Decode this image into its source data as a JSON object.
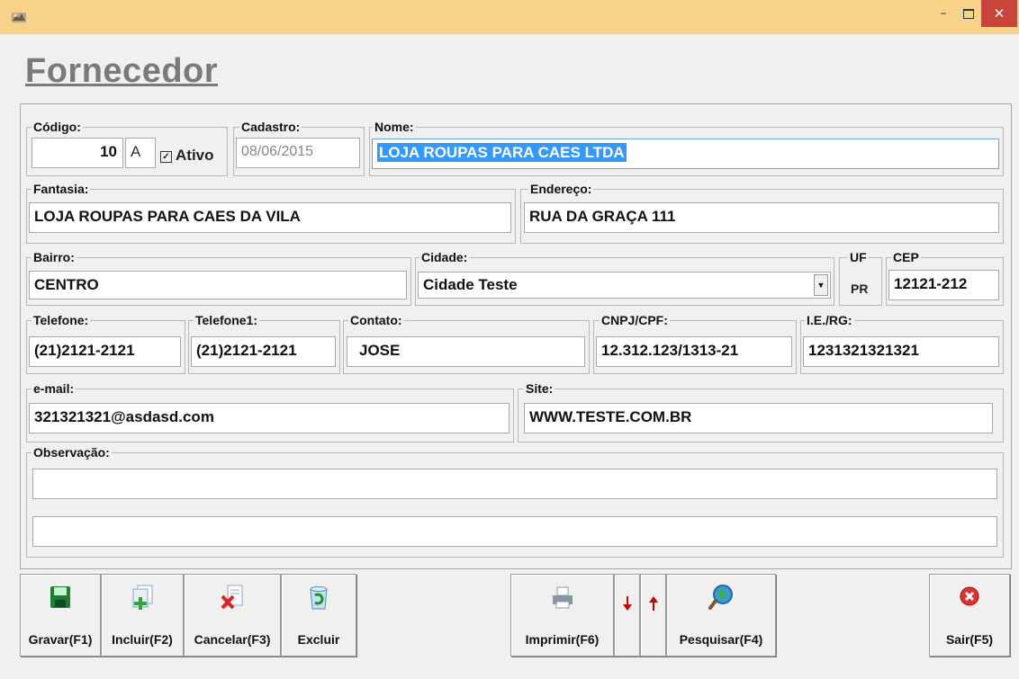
{
  "form": {
    "title": "Fornecedor"
  },
  "fields": {
    "codigo": {
      "label": "Código:",
      "value": "10",
      "type": "A",
      "ativo_label": "Ativo",
      "ativo_checked": true
    },
    "cadastro": {
      "label": "Cadastro:",
      "value": "08/06/2015"
    },
    "nome": {
      "label": "Nome:",
      "value": "LOJA ROUPAS PARA CAES LTDA"
    },
    "fantasia": {
      "label": "Fantasia:",
      "value": "LOJA ROUPAS PARA CAES DA VILA"
    },
    "endereco": {
      "label": "Endereço:",
      "value": "RUA DA GRAÇA 111"
    },
    "bairro": {
      "label": "Bairro:",
      "value": "CENTRO"
    },
    "cidade": {
      "label": "Cidade:",
      "value": "Cidade Teste"
    },
    "uf": {
      "label": "UF",
      "value": "PR"
    },
    "cep": {
      "label": "CEP",
      "value": "12121-212"
    },
    "telefone": {
      "label": "Telefone:",
      "value": "(21)2121-2121"
    },
    "telefone1": {
      "label": "Telefone1:",
      "value": "(21)2121-2121"
    },
    "contato": {
      "label": "Contato:",
      "value": "JOSE"
    },
    "cnpj": {
      "label": "CNPJ/CPF:",
      "value": "12.312.123/1313-21"
    },
    "ie": {
      "label": "I.E./RG:",
      "value": "1231321321321"
    },
    "email": {
      "label": "e-mail:",
      "value": "321321321@asdasd.com"
    },
    "site": {
      "label": "Site:",
      "value": "WWW.TESTE.COM.BR"
    },
    "observacao": {
      "label": "Observação:",
      "line1": "",
      "line2": ""
    }
  },
  "toolbar": {
    "gravar": "Gravar(F1)",
    "incluir": "Incluir(F2)",
    "cancelar": "Cancelar(F3)",
    "excluir": "Excluir",
    "imprimir": "Imprimir(F6)",
    "pesquisar": "Pesquisar(F4)",
    "sair": "Sair(F5)"
  },
  "icons": {
    "gravar": "floppy-disk-icon",
    "incluir": "add-document-icon",
    "cancelar": "cancel-document-icon",
    "excluir": "recycle-bin-icon",
    "imprimir": "printer-icon",
    "down": "arrow-down-icon",
    "up": "arrow-up-icon",
    "pesquisar": "search-globe-icon",
    "sair": "exit-icon"
  },
  "colors": {
    "titlebar": "#f6d389",
    "close": "#c9453b",
    "selection": "#3399ff",
    "arrow": "#cc0000"
  }
}
